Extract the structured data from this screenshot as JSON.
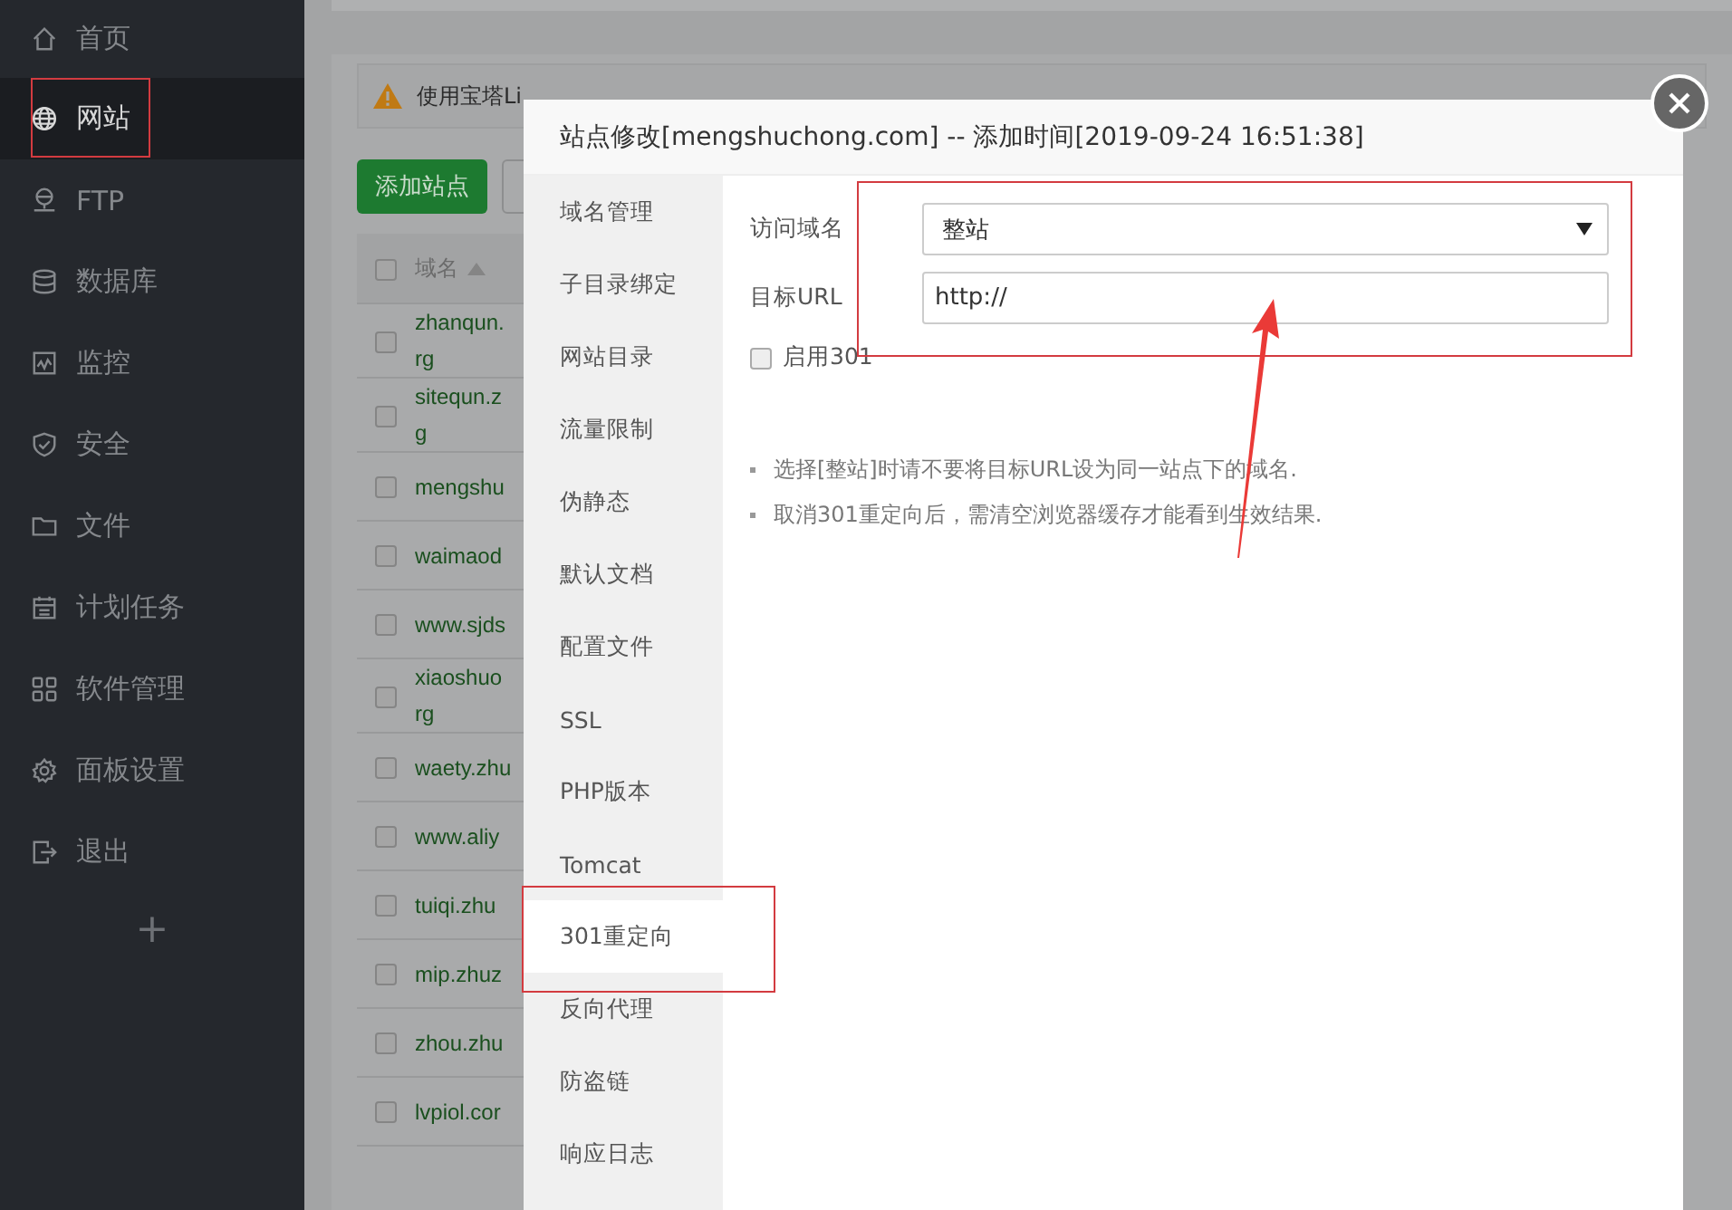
{
  "sidebar": {
    "items": [
      {
        "label": "首页",
        "selected": false
      },
      {
        "label": "网站",
        "selected": true
      },
      {
        "label": "FTP",
        "selected": false
      },
      {
        "label": "数据库",
        "selected": false
      },
      {
        "label": "监控",
        "selected": false
      },
      {
        "label": "安全",
        "selected": false
      },
      {
        "label": "文件",
        "selected": false
      },
      {
        "label": "计划任务",
        "selected": false
      },
      {
        "label": "软件管理",
        "selected": false
      },
      {
        "label": "面板设置",
        "selected": false
      },
      {
        "label": "退出",
        "selected": false
      }
    ],
    "add_label": "+"
  },
  "notice": {
    "text": "使用宝塔Li"
  },
  "toolbar": {
    "buttons": [
      "添加站点"
    ]
  },
  "table": {
    "columns": [
      "域名"
    ],
    "header_checked": false,
    "rows": [
      {
        "checked": false,
        "lines": [
          "zhanqun.",
          "rg"
        ]
      },
      {
        "checked": false,
        "lines": [
          "sitequn.z",
          "g"
        ]
      },
      {
        "checked": false,
        "lines": [
          "mengshu"
        ]
      },
      {
        "checked": false,
        "lines": [
          "waimaod"
        ]
      },
      {
        "checked": false,
        "lines": [
          "www.sjds"
        ]
      },
      {
        "checked": false,
        "lines": [
          "xiaoshuo",
          "rg"
        ]
      },
      {
        "checked": false,
        "lines": [
          "waety.zhu"
        ]
      },
      {
        "checked": false,
        "lines": [
          "www.aliy"
        ]
      },
      {
        "checked": false,
        "lines": [
          "tuiqi.zhu"
        ]
      },
      {
        "checked": false,
        "lines": [
          "mip.zhuz"
        ]
      },
      {
        "checked": false,
        "lines": [
          "zhou.zhu"
        ]
      },
      {
        "checked": false,
        "lines": [
          "lvpiol.cor"
        ]
      }
    ]
  },
  "dialog": {
    "title": "站点修改[mengshuchong.com] -- 添加时间[2019-09-24 16:51:38]",
    "tabs": [
      {
        "label": "域名管理",
        "selected": false
      },
      {
        "label": "子目录绑定",
        "selected": false
      },
      {
        "label": "网站目录",
        "selected": false
      },
      {
        "label": "流量限制",
        "selected": false
      },
      {
        "label": "伪静态",
        "selected": false
      },
      {
        "label": "默认文档",
        "selected": false
      },
      {
        "label": "配置文件",
        "selected": false
      },
      {
        "label": "SSL",
        "selected": false
      },
      {
        "label": "PHP版本",
        "selected": false
      },
      {
        "label": "Tomcat",
        "selected": false
      },
      {
        "label": "301重定向",
        "selected": true
      },
      {
        "label": "反向代理",
        "selected": false
      },
      {
        "label": "防盗链",
        "selected": false
      },
      {
        "label": "响应日志",
        "selected": false
      }
    ],
    "form": {
      "domain_label": "访问域名",
      "domain_value": "整站",
      "url_label": "目标URL",
      "url_value": "http://",
      "enable_label": "启用301",
      "enable_checked": false
    },
    "notes": [
      "选择[整站]时请不要将目标URL设为同一站点下的域名.",
      "取消301重定向后，需清空浏览器缓存才能看到生效结果."
    ]
  }
}
